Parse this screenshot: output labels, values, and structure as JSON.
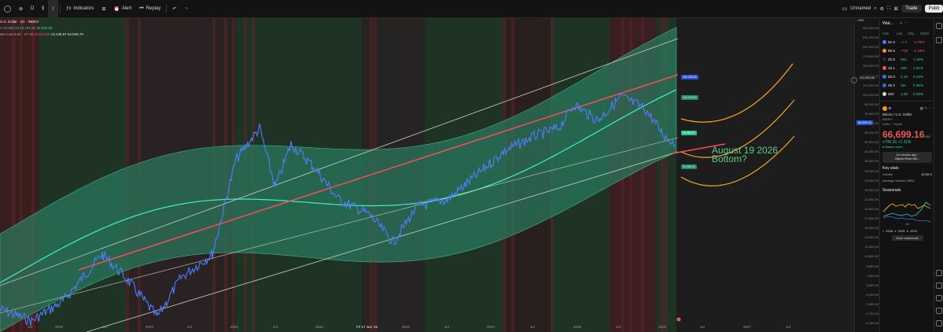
{
  "toolbar": {
    "timeframe": "D",
    "indicators": "Indicators",
    "alert": "Alert",
    "replay": "Replay",
    "layout_name": "Unnamed",
    "trade": "Trade",
    "publish": "Publi"
  },
  "legend": {
    "line1": "U.S. Dollar · 1D · INDEX",
    "line2_vals": "42,261.33  15,781.62  35,855.96",
    "line3_name": "wer Law 5.81 · 17 10",
    "line3_red": "34,843.60",
    "line3_vals": "13,136.67  52,546.70"
  },
  "annotation": {
    "line1": "August 19 2026",
    "line2": "Bottom?"
  },
  "price_axis": {
    "currency": "USD",
    "ticks": [
      "260,000.00",
      "230,000.00",
      "200,000.00",
      "170,000.00",
      "150,000.00",
      "130,000.00",
      "114,000.00",
      "100,000.00",
      "86,000.00",
      "76,000.00",
      "66,000.00",
      "58,000.00",
      "50,000.00",
      "44,000.00",
      "38,000.00",
      "33,000.00",
      "29,000.00",
      "25,000.00",
      "22,000.00",
      "19,500.00",
      "17,000.00",
      "15,000.00",
      "13,000.00",
      "11,500.00",
      "10,000.00",
      "8,800.00",
      "7,800.00",
      "6,800.00",
      "6,000.00",
      "5,300.00",
      "4,700.00",
      "4,160.00"
    ],
    "highlight": "122,850.86"
  },
  "x_axis": {
    "labels": [
      "Jul",
      "2019",
      "Jul",
      "2020",
      "Jul",
      "2021",
      "Jul",
      "2022",
      "Fri 17 Jun '22",
      "2023",
      "Jul",
      "2024",
      "Jul",
      "2025",
      "Jul",
      "2026",
      "Jul",
      "2027",
      "Jul"
    ]
  },
  "tags": {
    "upper_red": "162,253.00",
    "upper_band": "103,193.00",
    "current": "66,699.16",
    "mid": "56,066.00",
    "lower": "41,296.00"
  },
  "watchlist": {
    "title": "Wat...",
    "cols": [
      "Sym",
      "Las",
      "Chg",
      "Chg%"
    ],
    "rows": [
      {
        "sym": "51.0",
        "chg": "-1.4",
        "pct": "-2.79%",
        "color": "#4a78ff",
        "dir": "neg"
      },
      {
        "sym": "86.6",
        "chg": "-735",
        "pct": "-1.15%",
        "color": "#f7931a",
        "dir": "neg"
      },
      {
        "sym": "22.5",
        "chg": "262",
        "pct": "1.18%",
        "color": "#2a2a2a",
        "dir": "pos"
      },
      {
        "sym": "10.1",
        "chg": "169",
        "pct": "1.61%",
        "color": "#e85a5a",
        "dir": "pos"
      },
      {
        "sym": "53.3",
        "chg": "0.10",
        "pct": "0.19%",
        "color": "#3a6cf0",
        "dir": "pos"
      },
      {
        "sym": "45.2",
        "chg": "111",
        "pct": "0.25%",
        "color": "#2a6cd0",
        "dir": "pos"
      },
      {
        "sym": "452",
        "chg": "1.29",
        "pct": "0.28%",
        "color": "#dddddd",
        "dir": "pos"
      }
    ],
    "symbol_short": "B",
    "symbol_name": "Bitcoin / U.S. Dollar",
    "exchange": "INDEX",
    "type": "Index · Crypto",
    "price": "66,699.16",
    "price_ccy": "USD",
    "change": "+730.10  +1.11%",
    "status": "Market open",
    "news_line1": "18 minutes ago ·",
    "news_line2": "Bitcoin Price Wil...",
    "key_stats": "Key stats",
    "volume_label": "Volume",
    "volume_value": "15.53 K",
    "avg_volume_label": "Average Volume (30D)",
    "seasonals": "Seasonals",
    "season_years": [
      "2026",
      "2025",
      "2024"
    ],
    "season_month": "Jul",
    "more_seasonals": "More seasonals"
  }
}
